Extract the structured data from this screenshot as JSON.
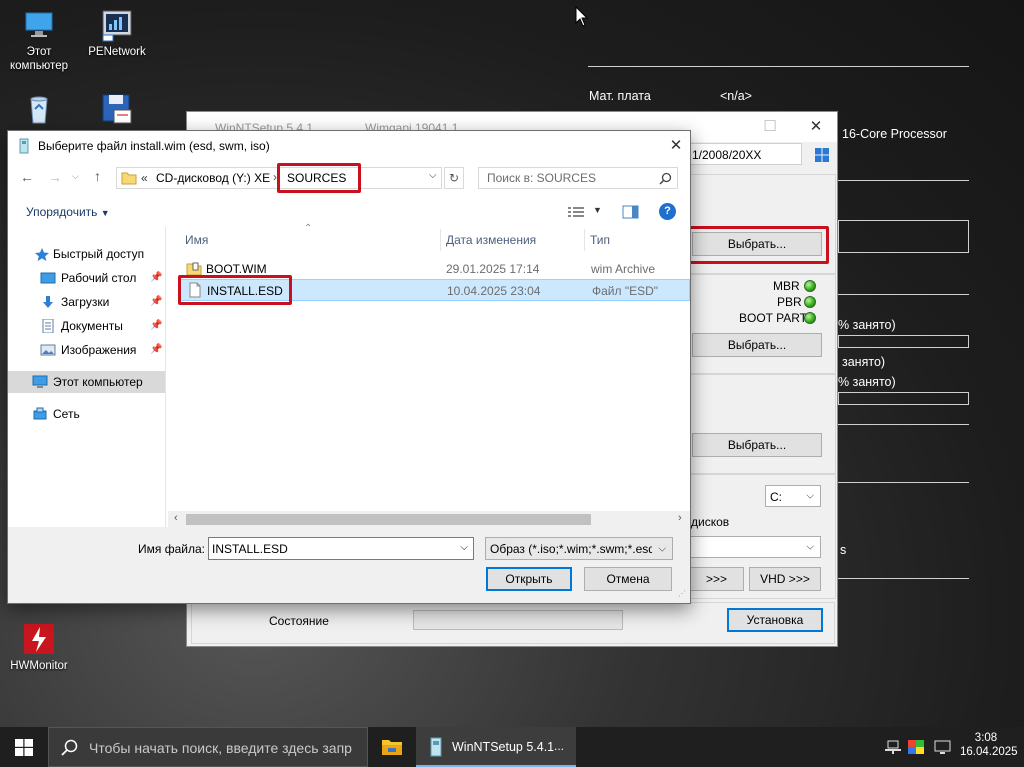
{
  "desktop": {
    "icons": [
      {
        "label": "Этот компьютер",
        "icon": "computer-icon"
      },
      {
        "label": "PENetwork",
        "icon": "network-tool-icon"
      },
      {
        "label": "recycle-bin",
        "icon": "recycle-bin-icon"
      },
      {
        "label": "",
        "icon": "floppy-calc-icon"
      },
      {
        "label": "HWMonitor",
        "icon": "hwmonitor-icon"
      }
    ]
  },
  "bginfo": {
    "motherboard_label": "Мат. плата",
    "motherboard_value": "<n/a>",
    "cpu_tail": "16-Core Processor",
    "disk1_tail": "% занято)",
    "disk2_tail": "занято)",
    "disk3_tail": "% занято)",
    "misc_tail": "s"
  },
  "winntsetup": {
    "title": "WinNTSetup 5.4.1",
    "subtitle": "Wimgapi 19041.1",
    "source_path": "1/2008/20XX",
    "select_button": "Выбрать...",
    "mbr": "MBR",
    "pbr": "PBR",
    "boot_part": "BOOT PART",
    "select_button_2": "Выбрать...",
    "select_button_3": "Выбрать...",
    "drive_letter": "C:",
    "disks_label": "дисков",
    "tweaks_button": ">>>",
    "vhd_button": "VHD >>>",
    "status_label": "Состояние",
    "install_button": "Установка"
  },
  "dialog": {
    "title": "Выберите файл install.wim (esd, swm, iso)",
    "breadcrumb_prefix": "«",
    "breadcrumb_drive": "CD-дисковод (Y:) XE",
    "breadcrumb_sep": "›",
    "breadcrumb_folder": "SOURCES",
    "search_placeholder": "Поиск в: SOURCES",
    "organize_label": "Упорядочить",
    "nav": [
      {
        "label": "Быстрый доступ",
        "icon": "star-icon",
        "pinned": false
      },
      {
        "label": "Рабочий стол",
        "icon": "desktop-folder-icon",
        "pinned": true
      },
      {
        "label": "Загрузки",
        "icon": "downloads-icon",
        "pinned": true
      },
      {
        "label": "Документы",
        "icon": "documents-icon",
        "pinned": true
      },
      {
        "label": "Изображения",
        "icon": "pictures-icon",
        "pinned": true
      },
      {
        "label": "Этот компьютер",
        "icon": "computer-icon",
        "pinned": false
      },
      {
        "label": "Сеть",
        "icon": "network-icon",
        "pinned": false
      }
    ],
    "columns": {
      "name": "Имя",
      "date": "Дата изменения",
      "type": "Тип"
    },
    "files": [
      {
        "name": "BOOT.WIM",
        "date": "29.01.2025 17:14",
        "type": "wim Archive",
        "selected": false
      },
      {
        "name": "INSTALL.ESD",
        "date": "10.04.2025 23:04",
        "type": "Файл \"ESD\"",
        "selected": true
      }
    ],
    "filename_label": "Имя файла:",
    "filename_value": "INSTALL.ESD",
    "filter_value": "Образ (*.iso;*.wim;*.swm;*.esd)",
    "open_button": "Открыть",
    "cancel_button": "Отмена"
  },
  "taskbar": {
    "search_placeholder": "Чтобы начать поиск, введите здесь запр",
    "app_label": "WinNTSetup 5.4.1",
    "app_more": "...",
    "time": "3:08",
    "date": "16.04.2025"
  }
}
